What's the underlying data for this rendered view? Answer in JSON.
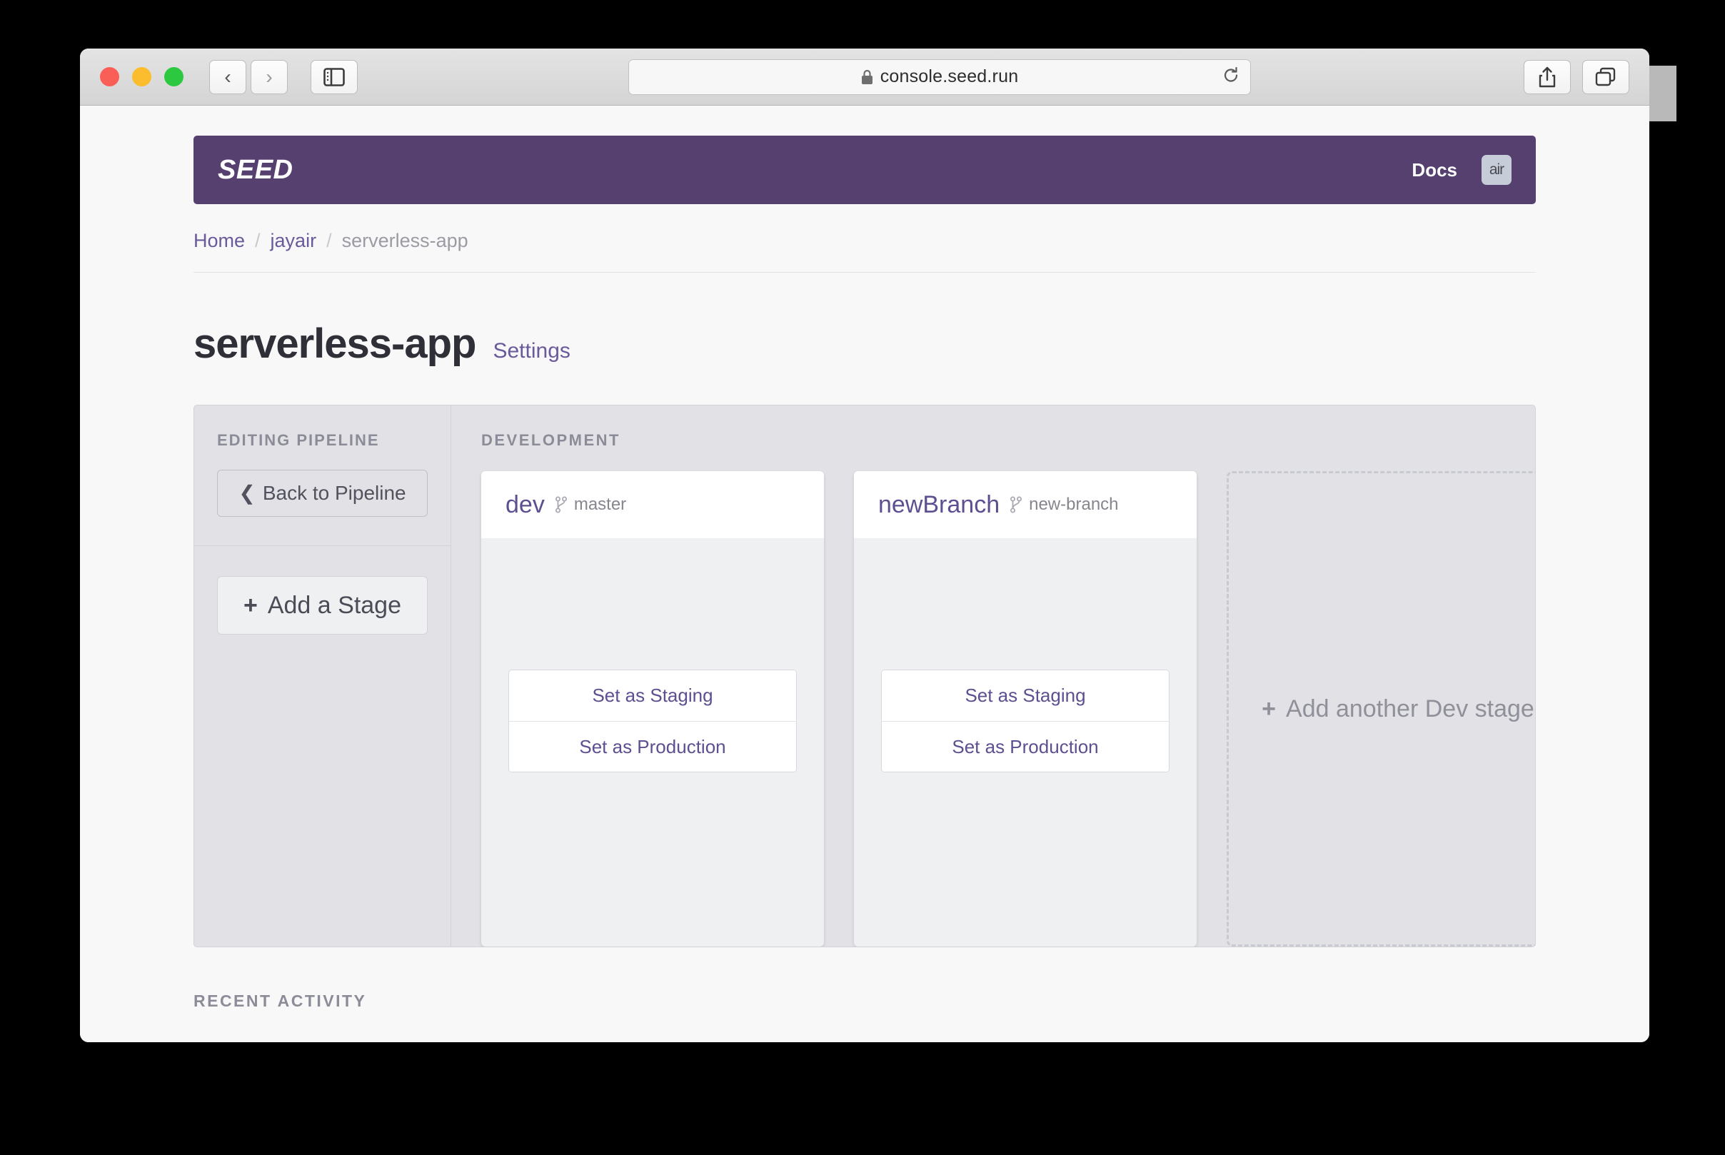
{
  "browser": {
    "url": "console.seed.run",
    "lock_icon": "lock-icon",
    "back_icon": "chevron-left-icon",
    "forward_icon": "chevron-right-icon",
    "sidebar_icon": "sidebar-toggle-icon",
    "reload_icon": "reload-icon",
    "share_icon": "share-icon",
    "tabs_icon": "show-tabs-icon",
    "newtab_label": "+"
  },
  "header": {
    "logo": "SEED",
    "docs_label": "Docs",
    "avatar_text": "air",
    "brand_color": "#564070"
  },
  "breadcrumb": {
    "items": [
      {
        "label": "Home",
        "current": false
      },
      {
        "label": "jayair",
        "current": false
      },
      {
        "label": "serverless-app",
        "current": true
      }
    ],
    "separator": "/"
  },
  "title": {
    "name": "serverless-app",
    "settings_label": "Settings"
  },
  "sidebar": {
    "section_label": "EDITING PIPELINE",
    "back_button": "Back to Pipeline",
    "back_icon": "chevron-left-icon",
    "add_stage_button": "Add a Stage",
    "add_icon": "plus-icon"
  },
  "pipeline": {
    "section_label": "DEVELOPMENT",
    "stages": [
      {
        "name": "dev",
        "branch": "master",
        "branch_icon": "git-branch-icon",
        "actions": [
          "Set as Staging",
          "Set as Production"
        ]
      },
      {
        "name": "newBranch",
        "branch": "new-branch",
        "branch_icon": "git-branch-icon",
        "actions": [
          "Set as Staging",
          "Set as Production"
        ]
      }
    ],
    "add_placeholder": {
      "label": "Add another Dev stage",
      "icon": "plus-icon"
    }
  },
  "recent_activity": {
    "label": "RECENT ACTIVITY"
  },
  "colors": {
    "accent": "#5e4f91",
    "panel_bg": "#e2e2e6",
    "card_bg": "#eef0f2",
    "page_bg": "#f8f8f9"
  }
}
